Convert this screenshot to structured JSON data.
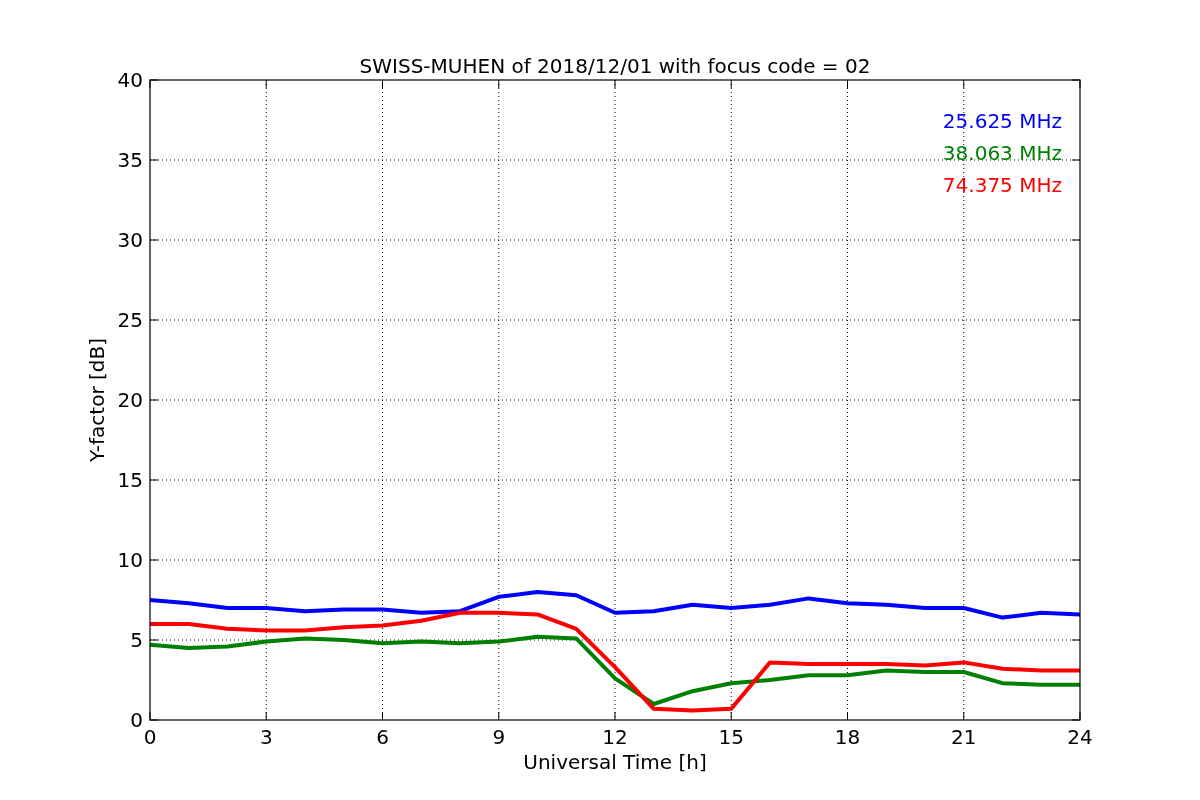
{
  "chart_data": {
    "type": "line",
    "title": "SWISS-MUHEN of 2018/12/01 with focus code = 02",
    "xlabel": "Universal Time [h]",
    "ylabel": "Y-factor [dB]",
    "x": [
      0,
      1,
      2,
      3,
      4,
      5,
      6,
      7,
      8,
      9,
      10,
      11,
      12,
      13,
      14,
      15,
      16,
      17,
      18,
      19,
      20,
      21,
      22,
      23,
      24
    ],
    "series": [
      {
        "name": "25.625 MHz",
        "color": "#0000ff",
        "values": [
          7.5,
          7.3,
          7.0,
          7.0,
          6.8,
          6.9,
          6.9,
          6.7,
          6.8,
          7.7,
          8.0,
          7.8,
          6.7,
          6.8,
          7.2,
          7.0,
          7.2,
          7.6,
          7.3,
          7.2,
          7.0,
          7.0,
          6.4,
          6.7,
          6.6
        ]
      },
      {
        "name": "38.063 MHz",
        "color": "#008000",
        "values": [
          4.7,
          4.5,
          4.6,
          4.9,
          5.1,
          5.0,
          4.8,
          4.9,
          4.8,
          4.9,
          5.2,
          5.1,
          2.6,
          1.0,
          1.8,
          2.3,
          2.5,
          2.8,
          2.8,
          3.1,
          3.0,
          3.0,
          2.3,
          2.2,
          2.2
        ]
      },
      {
        "name": "74.375 MHz",
        "color": "#ff0000",
        "values": [
          6.0,
          6.0,
          5.7,
          5.6,
          5.6,
          5.8,
          5.9,
          6.2,
          6.7,
          6.7,
          6.6,
          5.7,
          3.3,
          0.7,
          0.6,
          0.7,
          3.6,
          3.5,
          3.5,
          3.5,
          3.4,
          3.6,
          3.2,
          3.1,
          3.1
        ]
      }
    ],
    "xlim": [
      0,
      24
    ],
    "ylim": [
      0,
      40
    ],
    "xticks": [
      0,
      3,
      6,
      9,
      12,
      15,
      18,
      21,
      24
    ],
    "yticks": [
      0,
      5,
      10,
      15,
      20,
      25,
      30,
      35,
      40
    ],
    "grid": true
  }
}
